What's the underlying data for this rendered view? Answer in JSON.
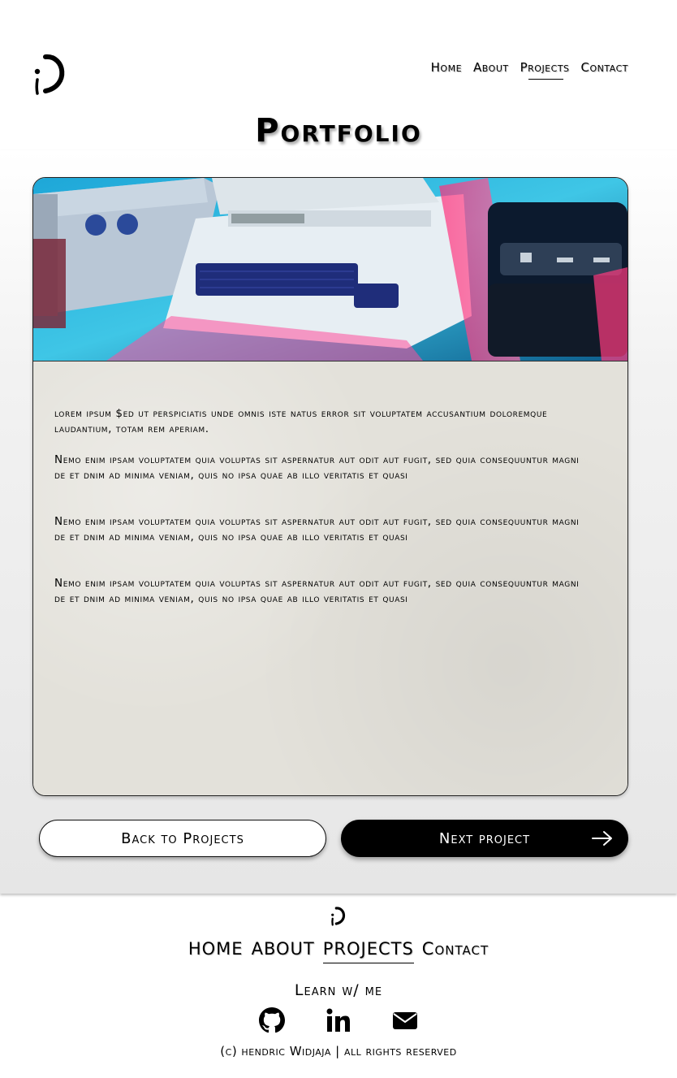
{
  "header": {
    "logo_alt": "winking smiley logo",
    "nav": [
      {
        "label": "Home",
        "active": false
      },
      {
        "label": "About",
        "active": false
      },
      {
        "label": "Projects",
        "active": true
      },
      {
        "label": "Contact",
        "active": false
      }
    ]
  },
  "page": {
    "title": "Portfolio"
  },
  "project": {
    "hero_image": "retro-computers-photo",
    "paragraphs": [
      "lorem ipsum $ed ut perspiciatis unde omnis iste natus error sit voluptatem accusantium doloremque laudantium, totam rem aperiam.",
      "Nemo enim ipsam voluptatem quia voluptas sit aspernatur aut odit aut fugit, sed quia consequuntur magni de et dnim ad minima veniam, quis no ipsa quae ab illo  veritatis et quasi",
      "Nemo enim ipsam voluptatem quia voluptas sit aspernatur aut odit aut fugit, sed quia consequuntur magni de et dnim ad minima veniam, quis no ipsa quae ab illo  veritatis et quasi",
      "Nemo enim ipsam voluptatem quia voluptas sit aspernatur aut odit aut fugit, sed quia consequuntur magni de et dnim ad minima veniam, quis no ipsa quae ab illo  veritatis et quasi"
    ]
  },
  "buttons": {
    "back_label": "Back to Projects",
    "next_label": "Next project"
  },
  "footer": {
    "nav": [
      {
        "label": "HOME",
        "active": false
      },
      {
        "label": "ABOUT",
        "active": false
      },
      {
        "label": "PROJECTS",
        "active": true
      },
      {
        "label": "Contact",
        "active": false
      }
    ],
    "learn_label": "Learn w/ me",
    "social_icons": [
      "github-icon",
      "linkedin-icon",
      "email-icon"
    ],
    "copyright": "(c) hendric Widjaja | all rights reserved"
  },
  "colors": {
    "background": "#ffffff",
    "band": "#e6e6e6",
    "accent": "#000000",
    "button_text_light": "#ffffff"
  }
}
